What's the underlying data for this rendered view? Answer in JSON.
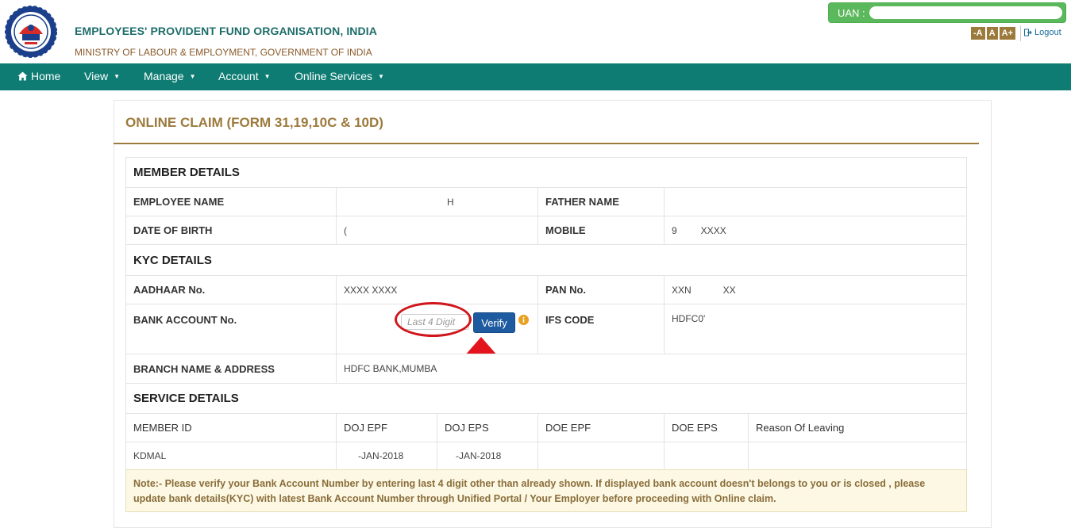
{
  "header": {
    "org_title": "EMPLOYEES' PROVIDENT FUND ORGANISATION, INDIA",
    "org_subtitle": "MINISTRY OF LABOUR & EMPLOYMENT, GOVERNMENT OF INDIA",
    "uan_label": "UAN :",
    "font_decrease": "-A",
    "font_normal": "A",
    "font_increase": "A+",
    "logout": "Logout",
    "colors": {
      "teal": "#0e7c73",
      "gold": "#9c7a3c",
      "green": "#5cb85c"
    }
  },
  "nav": {
    "home": "Home",
    "view": "View",
    "manage": "Manage",
    "account": "Account",
    "online_services": "Online Services"
  },
  "page_title": "ONLINE CLAIM (FORM 31,19,10C & 10D)",
  "member_details": {
    "heading": "MEMBER DETAILS",
    "employee_name_label": "EMPLOYEE NAME",
    "employee_name_value": "H",
    "father_name_label": "FATHER NAME",
    "father_name_value": "",
    "dob_label": "DATE OF BIRTH",
    "dob_value": "(",
    "mobile_label": "MOBILE",
    "mobile_value": "9         XXXX"
  },
  "kyc_details": {
    "heading": "KYC DETAILS",
    "aadhaar_label": "AADHAAR No.",
    "aadhaar_value": "XXXX XXXX",
    "pan_label": "PAN No.",
    "pan_value": "XXN            XX",
    "bank_account_label": "BANK ACCOUNT No.",
    "bank_account_placeholder": "Last 4 Digit",
    "verify_button": "Verify",
    "ifs_label": "IFS CODE",
    "ifs_value": "HDFC0'",
    "branch_label": "BRANCH NAME & ADDRESS",
    "branch_value": "HDFC BANK,MUMBA"
  },
  "service_details": {
    "heading": "SERVICE DETAILS",
    "columns": [
      "MEMBER ID",
      "DOJ EPF",
      "DOJ EPS",
      "DOE EPF",
      "DOE EPS",
      "Reason Of Leaving"
    ],
    "rows": [
      [
        "KDMAL",
        "-JAN-2018",
        "-JAN-2018",
        "",
        "",
        ""
      ]
    ]
  },
  "note": "Note:- Please verify your Bank Account Number by entering last 4 digit other than already shown. If displayed bank account doesn't belongs to you or is closed , please update bank details(KYC) with latest Bank Account Number through Unified Portal / Your Employer before proceeding with Online claim."
}
